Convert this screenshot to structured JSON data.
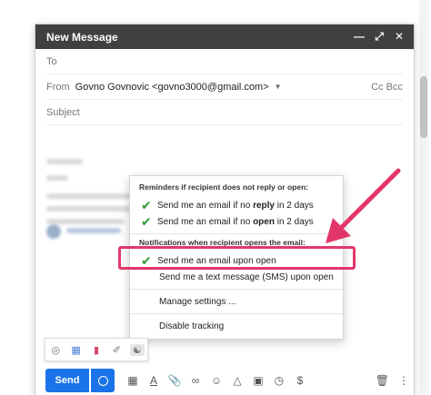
{
  "compose": {
    "title": "New Message",
    "to_label": "To",
    "from_label": "From",
    "from_value": "Govno Govnovic <govno3000@gmail.com>",
    "cc_bcc": "Cc Bcc",
    "subject_placeholder": "Subject",
    "window_icons": [
      "minimize-icon",
      "expand-icon",
      "close-icon"
    ]
  },
  "popup": {
    "header_reminders": "Reminders if recipient does not reply or open:",
    "reminder_reply_prefix": "Send me an email if no ",
    "reminder_reply_bold": "reply",
    "reminder_reply_suffix": " in 2 days",
    "reminder_open_prefix": "Send me an email if no ",
    "reminder_open_bold": "open",
    "reminder_open_suffix": " in 2 days",
    "header_notifications": "Notifications when recipient opens the email:",
    "notify_email": "Send me an email upon open",
    "notify_sms": "Send me a text message (SMS) upon open",
    "manage_settings": "Manage settings ...",
    "disable_tracking": "Disable tracking"
  },
  "bottom": {
    "send_label": "Send"
  },
  "colors": {
    "accent_blue": "#1a73e8",
    "highlight_pink": "#e23669",
    "check_green": "#2e9b3a",
    "titlebar_dark": "#404040"
  }
}
